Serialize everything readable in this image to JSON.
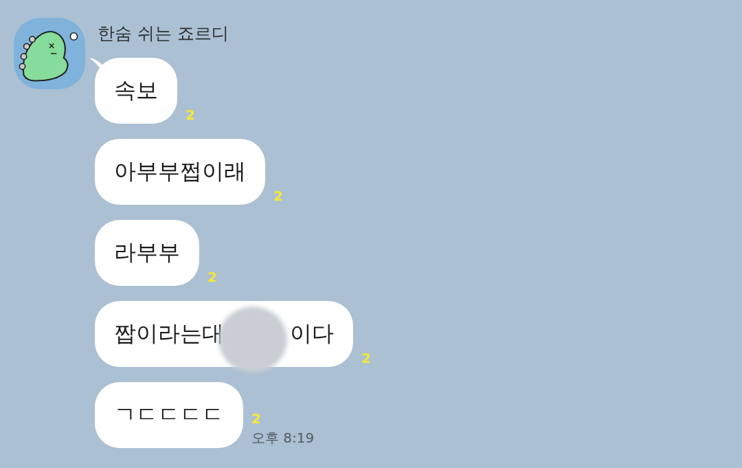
{
  "sender": {
    "name": "한숨 쉬는 죠르디"
  },
  "messages": [
    {
      "kind": "text",
      "text": "속보",
      "unread": "2"
    },
    {
      "kind": "text",
      "text": "아부부쩝이래",
      "unread": "2"
    },
    {
      "kind": "text",
      "text": "라부부",
      "unread": "2"
    },
    {
      "kind": "redacted",
      "before": "짭이라는대",
      "after": "이다",
      "unread": "2"
    },
    {
      "kind": "text",
      "text": "ㄱㄷㄷㄷㄷ",
      "unread": "2",
      "time": "오후 8:19"
    }
  ]
}
